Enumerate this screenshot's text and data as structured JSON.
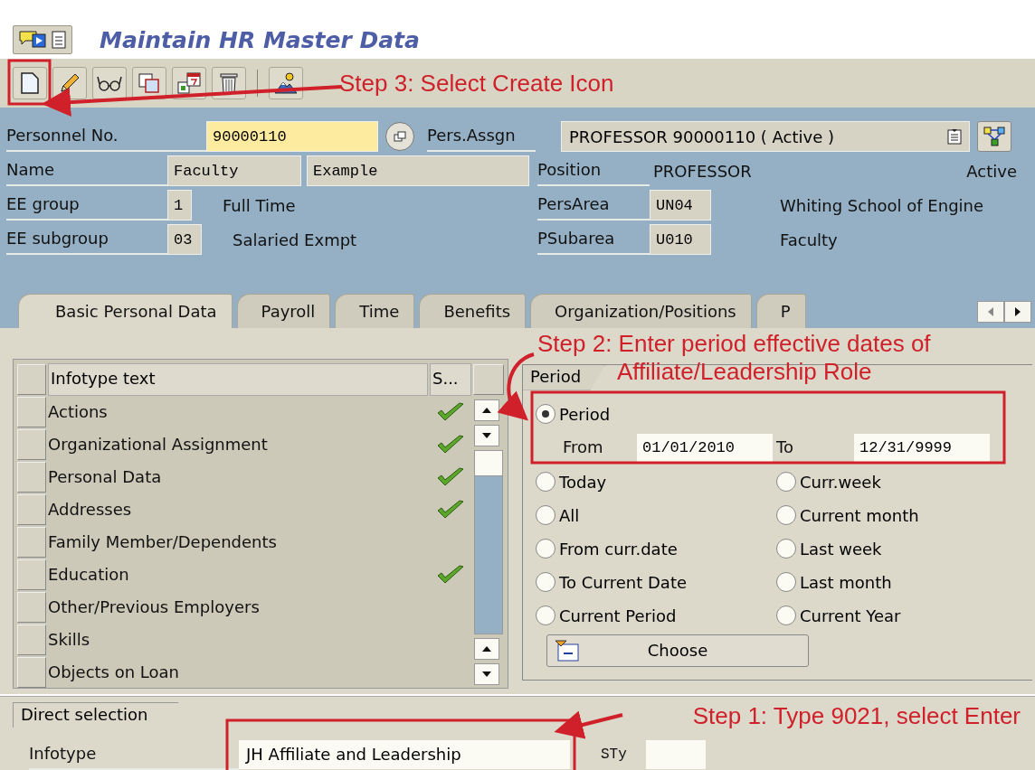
{
  "title": "Maintain HR Master Data",
  "annotations": [
    {
      "lines": [
        "Step 3: Select Create Icon"
      ]
    },
    {
      "lines": [
        "Step 2: Enter period effective dates of",
        "Affiliate/Leadership Role"
      ]
    },
    {
      "lines": [
        "Step 1: Type 9021, select Enter"
      ]
    }
  ],
  "personnel": {
    "label": "Personnel No.",
    "value": "90000110",
    "assignment_label": "Pers.Assgn",
    "assignment_value": "PROFESSOR 90000110 ( Active )"
  },
  "rows": [
    {
      "label": "Name",
      "values": [
        "Faculty",
        "Example"
      ],
      "right_label": "Position",
      "right_text": "PROFESSOR",
      "status": "Active"
    },
    {
      "label": "EE group",
      "values": [
        "1"
      ],
      "text": "Full Time",
      "right_label": "PersArea",
      "right_values": [
        "UN04"
      ],
      "right_text": "Whiting School of Engine"
    },
    {
      "label": "EE subgroup",
      "values": [
        "03"
      ],
      "text": "Salaried Exmpt",
      "right_label": "PSubarea",
      "right_values": [
        "U010"
      ],
      "right_text": "Faculty"
    }
  ],
  "tabs": [
    {
      "label": "Basic Personal Data",
      "selected": true
    },
    {
      "label": "Payroll",
      "selected": false
    },
    {
      "label": "Time",
      "selected": false
    },
    {
      "label": "Benefits",
      "selected": false
    },
    {
      "label": "Organization/Positions",
      "selected": false
    },
    {
      "label": "P",
      "selected": false
    }
  ],
  "table": {
    "columns": [
      "Infotype text",
      "S..."
    ],
    "rows": [
      {
        "text": "Actions",
        "checked": true
      },
      {
        "text": "Organizational Assignment",
        "checked": true
      },
      {
        "text": "Personal Data",
        "checked": true
      },
      {
        "text": "Addresses",
        "checked": true
      },
      {
        "text": "Family Member/Dependents",
        "checked": false
      },
      {
        "text": "Education",
        "checked": true
      },
      {
        "text": "Other/Previous Employers",
        "checked": false
      },
      {
        "text": "Skills",
        "checked": false
      },
      {
        "text": "Objects on Loan",
        "checked": false
      }
    ]
  },
  "period": {
    "group_label": "Period",
    "main_option": {
      "label": "Period",
      "selected": true
    },
    "from_label": "From",
    "from": "01/01/2010",
    "to_label": "To",
    "to": "12/31/9999",
    "options": [
      {
        "label": "Today",
        "selected": false
      },
      {
        "label": "Curr.week",
        "selected": false
      },
      {
        "label": "All",
        "selected": false
      },
      {
        "label": "Current month",
        "selected": false
      },
      {
        "label": "From curr.date",
        "selected": false
      },
      {
        "label": "Last week",
        "selected": false
      },
      {
        "label": "To Current Date",
        "selected": false
      },
      {
        "label": "Last month",
        "selected": false
      },
      {
        "label": "Current Period",
        "selected": false
      },
      {
        "label": "Current Year",
        "selected": false
      }
    ],
    "button": "Choose"
  },
  "direct_selection": {
    "group_label": "Direct selection",
    "infotype_label": "Infotype",
    "infotype_value": "JH Affiliate and Leadership",
    "subtype_label": "STy"
  }
}
